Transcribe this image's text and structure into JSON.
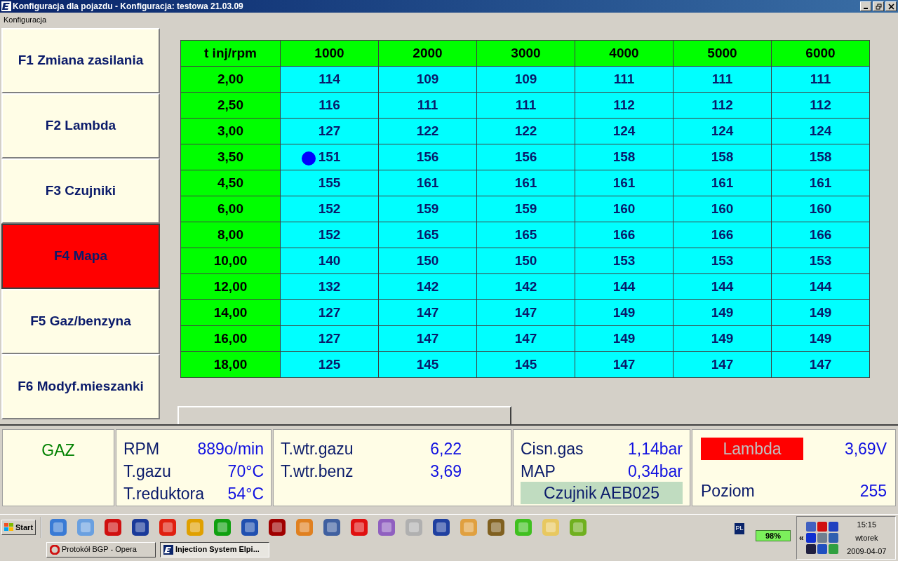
{
  "window": {
    "title": "Konfiguracja dla pojazdu - Konfiguracja: testowa 21.03.09"
  },
  "menu": [
    "Konfiguracja"
  ],
  "sidebar": [
    {
      "label": "F1 Zmiana zasilania",
      "selected": false
    },
    {
      "label": "F2 Lambda",
      "selected": false
    },
    {
      "label": "F3 Czujniki",
      "selected": false
    },
    {
      "label": "F4 Mapa",
      "selected": true
    },
    {
      "label": "F5 Gaz/benzyna",
      "selected": false
    },
    {
      "label": "F6 Modyf.mieszanki",
      "selected": false
    }
  ],
  "table": {
    "corner": "t inj/rpm",
    "columns": [
      "1000",
      "2000",
      "3000",
      "4000",
      "5000",
      "6000"
    ],
    "rows": [
      {
        "label": "2,00",
        "cells": [
          {
            "value": "114",
            "dot": false
          },
          {
            "value": "109",
            "dot": false
          },
          {
            "value": "109",
            "dot": false
          },
          {
            "value": "111",
            "dot": false
          },
          {
            "value": "111",
            "dot": false
          },
          {
            "value": "111",
            "dot": false
          }
        ]
      },
      {
        "label": "2,50",
        "cells": [
          {
            "value": "116",
            "dot": false
          },
          {
            "value": "111",
            "dot": false
          },
          {
            "value": "111",
            "dot": false
          },
          {
            "value": "112",
            "dot": false
          },
          {
            "value": "112",
            "dot": false
          },
          {
            "value": "112",
            "dot": false
          }
        ]
      },
      {
        "label": "3,00",
        "cells": [
          {
            "value": "127",
            "dot": false
          },
          {
            "value": "122",
            "dot": false
          },
          {
            "value": "122",
            "dot": false
          },
          {
            "value": "124",
            "dot": false
          },
          {
            "value": "124",
            "dot": false
          },
          {
            "value": "124",
            "dot": false
          }
        ]
      },
      {
        "label": "3,50",
        "cells": [
          {
            "value": "151",
            "dot": true
          },
          {
            "value": "156",
            "dot": false
          },
          {
            "value": "156",
            "dot": false
          },
          {
            "value": "158",
            "dot": false
          },
          {
            "value": "158",
            "dot": false
          },
          {
            "value": "158",
            "dot": false
          }
        ]
      },
      {
        "label": "4,50",
        "cells": [
          {
            "value": "155",
            "dot": false
          },
          {
            "value": "161",
            "dot": false
          },
          {
            "value": "161",
            "dot": false
          },
          {
            "value": "161",
            "dot": false
          },
          {
            "value": "161",
            "dot": false
          },
          {
            "value": "161",
            "dot": false
          }
        ]
      },
      {
        "label": "6,00",
        "cells": [
          {
            "value": "152",
            "dot": false
          },
          {
            "value": "159",
            "dot": false
          },
          {
            "value": "159",
            "dot": false
          },
          {
            "value": "160",
            "dot": false
          },
          {
            "value": "160",
            "dot": false
          },
          {
            "value": "160",
            "dot": false
          }
        ]
      },
      {
        "label": "8,00",
        "cells": [
          {
            "value": "152",
            "dot": false
          },
          {
            "value": "165",
            "dot": false
          },
          {
            "value": "165",
            "dot": false
          },
          {
            "value": "166",
            "dot": false
          },
          {
            "value": "166",
            "dot": false
          },
          {
            "value": "166",
            "dot": false
          }
        ]
      },
      {
        "label": "10,00",
        "cells": [
          {
            "value": "140",
            "dot": false
          },
          {
            "value": "150",
            "dot": false
          },
          {
            "value": "150",
            "dot": false
          },
          {
            "value": "153",
            "dot": false
          },
          {
            "value": "153",
            "dot": false
          },
          {
            "value": "153",
            "dot": false
          }
        ]
      },
      {
        "label": "12,00",
        "cells": [
          {
            "value": "132",
            "dot": false
          },
          {
            "value": "142",
            "dot": false
          },
          {
            "value": "142",
            "dot": false
          },
          {
            "value": "144",
            "dot": false
          },
          {
            "value": "144",
            "dot": false
          },
          {
            "value": "144",
            "dot": false
          }
        ]
      },
      {
        "label": "14,00",
        "cells": [
          {
            "value": "127",
            "dot": false
          },
          {
            "value": "147",
            "dot": false
          },
          {
            "value": "147",
            "dot": false
          },
          {
            "value": "149",
            "dot": false
          },
          {
            "value": "149",
            "dot": false
          },
          {
            "value": "149",
            "dot": false
          }
        ]
      },
      {
        "label": "16,00",
        "cells": [
          {
            "value": "127",
            "dot": false
          },
          {
            "value": "147",
            "dot": false
          },
          {
            "value": "147",
            "dot": false
          },
          {
            "value": "149",
            "dot": false
          },
          {
            "value": "149",
            "dot": false
          },
          {
            "value": "149",
            "dot": false
          }
        ]
      },
      {
        "label": "18,00",
        "cells": [
          {
            "value": "125",
            "dot": false
          },
          {
            "value": "145",
            "dot": false
          },
          {
            "value": "145",
            "dot": false
          },
          {
            "value": "147",
            "dot": false
          },
          {
            "value": "147",
            "dot": false
          },
          {
            "value": "147",
            "dot": false
          }
        ]
      }
    ]
  },
  "status": {
    "fuel": "GAZ",
    "group_1": [
      {
        "label": "RPM",
        "value": "889o/min"
      },
      {
        "label": "T.gazu",
        "value": "70°C"
      },
      {
        "label": "T.reduktora",
        "value": "54°C"
      }
    ],
    "group_2": [
      {
        "label": "T.wtr.gazu",
        "value": "6,22"
      },
      {
        "label": "T.wtr.benz",
        "value": "3,69"
      }
    ],
    "group_3": [
      {
        "label": "Cisn.gas",
        "value": "1,14bar"
      },
      {
        "label": "MAP",
        "value": "0,34bar"
      }
    ],
    "sensor": "Czujnik AEB025",
    "lambda": {
      "label": "Lambda",
      "value": "3,69V"
    },
    "level": {
      "label": "Poziom",
      "value": "255"
    }
  },
  "taskbar": {
    "start": "Start",
    "tasks": [
      {
        "label": "Protokół BGP - Opera",
        "selected": false
      },
      {
        "label": "Injection System Elpi...",
        "selected": true
      }
    ],
    "language": "PL",
    "battery": "98%",
    "clock": [
      "15:15",
      "wtorek",
      "2009-04-07"
    ],
    "tray_toggle": "«"
  }
}
